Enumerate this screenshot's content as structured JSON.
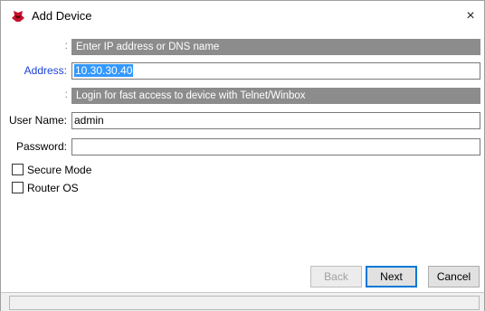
{
  "window": {
    "title": "Add Device",
    "close_glyph": "×",
    "icon": "mikrotik-device-icon"
  },
  "form": {
    "address_hint_colon": ":",
    "address_hint": "Enter IP address or DNS name",
    "address_label": "Address:",
    "address_value": "10.30.30.40",
    "login_hint_colon": ":",
    "login_hint": "Login for fast access to device with Telnet/Winbox",
    "username_label": "User Name:",
    "username_value": "admin",
    "password_label": "Password:",
    "password_value": "",
    "secure_mode_label": "Secure Mode",
    "secure_mode_checked": false,
    "router_os_label": "Router OS",
    "router_os_checked": false
  },
  "buttons": {
    "back": "Back",
    "next": "Next",
    "cancel": "Cancel"
  },
  "colors": {
    "hint_bg": "#8c8c8c",
    "address_label": "#1c3fd6",
    "selection": "#3399ff"
  }
}
